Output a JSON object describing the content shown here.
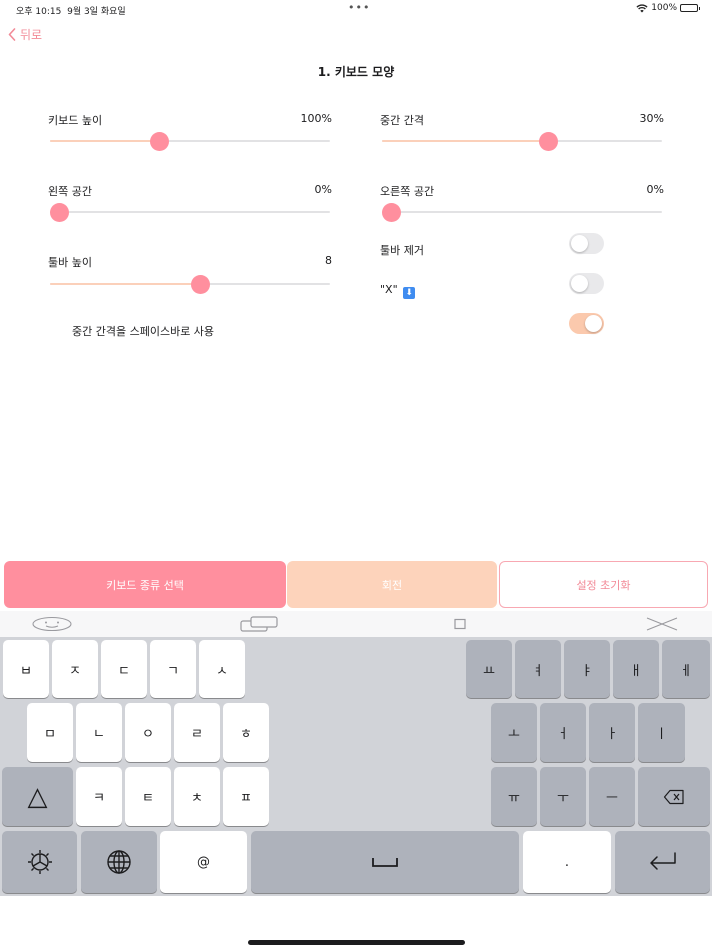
{
  "status_bar": {
    "time": "오후 10:15",
    "date": "9월 3일 화요일",
    "dots": "•••",
    "battery": "100%"
  },
  "nav": {
    "back_label": "뒤로"
  },
  "page": {
    "title": "1. 키보드 모양"
  },
  "settings": {
    "keyboard_height": {
      "label": "키보드 높이",
      "value": "100%",
      "level": 0.38
    },
    "middle_gap": {
      "label": "중간 간격",
      "value": "30%",
      "level": 0.6
    },
    "left_space": {
      "label": "왼쪽 공간",
      "value": "0%",
      "level": 0.0
    },
    "right_space": {
      "label": "오른쪽 공간",
      "value": "0%",
      "level": 0.0
    },
    "toolbar_height": {
      "label": "툴바 높이",
      "value": "8",
      "level": 0.54
    },
    "remove_toolbar": {
      "label": "툴바 제거",
      "on": false
    },
    "x_key": {
      "label": "\"X\"",
      "emoji": "⬇",
      "on": false
    },
    "gap_as_space": {
      "label": "중간 간격을 스페이스바로 사용",
      "on": true
    }
  },
  "actions": {
    "select_keyboard": "키보드 종류 선택",
    "rotate": "회전",
    "reset": "설정 초기화"
  },
  "toolbar": {
    "icons": [
      "emoji-face-icon",
      "clipboard-icon",
      "single-window-icon",
      "close-icon"
    ]
  },
  "keyboard": {
    "left_row1": [
      "ㅂ",
      "ㅈ",
      "ㄷ",
      "ㄱ",
      "ㅅ"
    ],
    "left_row2": [
      "ㅁ",
      "ㄴ",
      "ㅇ",
      "ㄹ",
      "ㅎ"
    ],
    "left_row3": [
      "ㅋ",
      "ㅌ",
      "ㅊ",
      "ㅍ"
    ],
    "right_row1": [
      "ㅛ",
      "ㅕ",
      "ㅑ",
      "ㅐ",
      "ㅔ"
    ],
    "right_row2": [
      "ㅗ",
      "ㅓ",
      "ㅏ",
      "ㅣ"
    ],
    "right_row3": [
      "ㅠ",
      "ㅜ",
      "ㅡ"
    ],
    "at_key": "@",
    "period_key": ".",
    "shift_symbol": "△",
    "space_symbol": "⎵"
  },
  "colors": {
    "accent": "#ff8f9e",
    "accent_light": "#fdd3bb",
    "back": "#f28a97"
  }
}
